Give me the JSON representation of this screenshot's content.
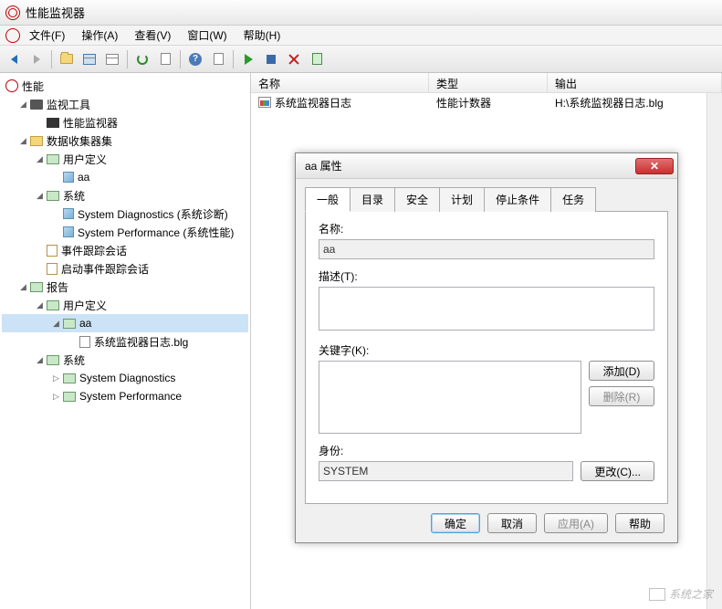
{
  "window": {
    "title": "性能监视器"
  },
  "menu": {
    "file": "文件(F)",
    "action": "操作(A)",
    "view": "查看(V)",
    "window": "窗口(W)",
    "help": "帮助(H)"
  },
  "tree": {
    "root": "性能",
    "monitor_tools": "监视工具",
    "perf_monitor": "性能监视器",
    "dcs": "数据收集器集",
    "user_defined": "用户定义",
    "aa": "aa",
    "system": "系统",
    "sysdiag": "System Diagnostics (系统诊断)",
    "sysperf": "System Performance (系统性能)",
    "event_sessions": "事件跟踪会话",
    "startup_sessions": "启动事件跟踪会话",
    "reports": "报告",
    "user_defined2": "用户定义",
    "aa2": "aa",
    "log_file": "系统监视器日志.blg",
    "system2": "系统",
    "sysdiag2": "System Diagnostics",
    "sysperf2": "System Performance"
  },
  "list": {
    "hdr_name": "名称",
    "hdr_type": "类型",
    "hdr_output": "输出",
    "row1_name": "系统监视器日志",
    "row1_type": "性能计数器",
    "row1_output": "H:\\系统监视器日志.blg"
  },
  "dialog": {
    "title": "aa 属性",
    "tabs": {
      "general": "一般",
      "dir": "目录",
      "security": "安全",
      "plan": "计划",
      "stop": "停止条件",
      "task": "任务"
    },
    "name_label": "名称:",
    "name_value": "aa",
    "desc_label": "描述(T):",
    "desc_value": "",
    "kw_label": "关键字(K):",
    "add_btn": "添加(D)",
    "del_btn": "删除(R)",
    "id_label": "身份:",
    "id_value": "SYSTEM",
    "change_btn": "更改(C)...",
    "ok": "确定",
    "cancel": "取消",
    "apply": "应用(A)",
    "help": "帮助"
  },
  "watermark": "系统之家"
}
